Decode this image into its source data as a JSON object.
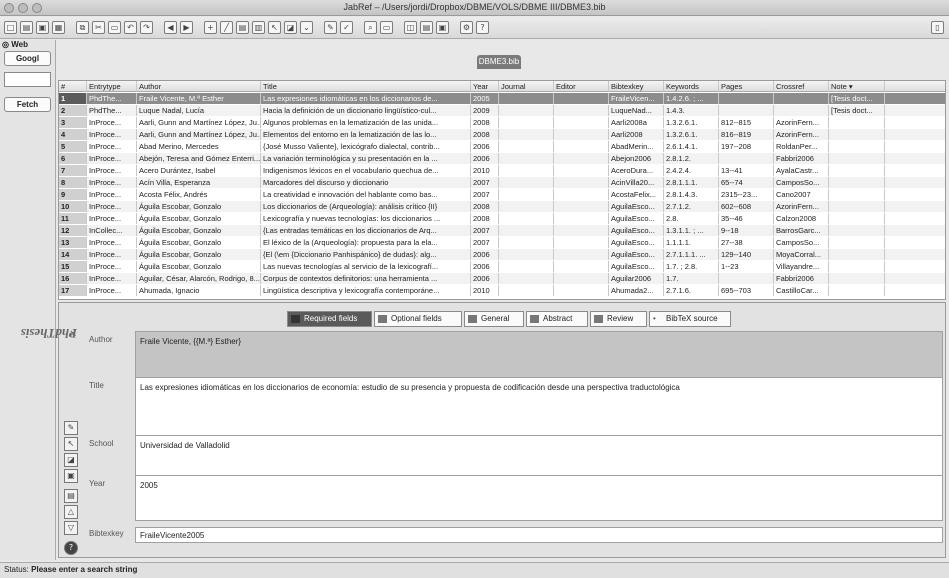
{
  "window": {
    "title": "JabRef – /Users/jordi/Dropbox/DBME/VOLS/DBME III/DBME3.bib"
  },
  "side": {
    "header": "Web",
    "google_label": "Googl",
    "fetch_label": "Fetch"
  },
  "db_tab": "DBME3.bib",
  "table": {
    "columns": [
      "#",
      "Entrytype",
      "Author",
      "Title",
      "Year",
      "Journal",
      "Editor",
      "Bibtexkey",
      "Keywords",
      "Pages",
      "Crossref",
      "Note ▾"
    ],
    "rows": [
      [
        "1",
        "PhdThe...",
        "Fraile Vicente, M.ª Esther",
        "Las expresiones idiomáticas en los diccionarios de...",
        "2005",
        "",
        "",
        "FraileVicen...",
        "1.4.2.6. ; ...",
        "",
        "",
        "[Tesis doct..."
      ],
      [
        "2",
        "PhdThe...",
        "Luque Nadal, Lucía",
        "Hacia la definición de un diccionario lingüístico-cul...",
        "2009",
        "",
        "",
        "LuqueNad...",
        "1.4.3.",
        "",
        "",
        "[Tesis doct..."
      ],
      [
        "3",
        "InProce...",
        "Aarli, Gunn and Martínez López, Ju...",
        "Algunos problemas en la lematización de las unida...",
        "2008",
        "",
        "",
        "Aarli2008a",
        "1.3.2.6.1.",
        "812--815",
        "AzorinFern...",
        ""
      ],
      [
        "4",
        "InProce...",
        "Aarli, Gunn and Martínez López, Ju...",
        "Elementos del entorno en la lematización de las lo...",
        "2008",
        "",
        "",
        "Aarli2008",
        "1.3.2.6.1.",
        "816--819",
        "AzorinFern...",
        ""
      ],
      [
        "5",
        "InProce...",
        "Abad Merino, Mercedes",
        "{José Musso Valiente}, lexicógrafo dialectal, contrib...",
        "2006",
        "",
        "",
        "AbadMerin...",
        "2.6.1.4.1.",
        "197--208",
        "RoldanPer...",
        ""
      ],
      [
        "6",
        "InProce...",
        "Abejón, Teresa and Gómez Enterri...",
        "La variación terminológica y su presentación en la ...",
        "2006",
        "",
        "",
        "Abejon2006",
        "2.8.1.2.",
        "",
        "Fabbri2006",
        ""
      ],
      [
        "7",
        "InProce...",
        "Acero Durántez, Isabel",
        "Indigenismos léxicos en el vocabulario quechua de...",
        "2010",
        "",
        "",
        "AceroDura...",
        "2.4.2.4.",
        "13--41",
        "AyalaCastr...",
        ""
      ],
      [
        "8",
        "InProce...",
        "Acín Villa, Esperanza",
        "Marcadores del discurso y diccionario",
        "2007",
        "",
        "",
        "AcinVilla20...",
        "2.8.1.1.1.",
        "65--74",
        "CamposSo...",
        ""
      ],
      [
        "9",
        "InProce...",
        "Acosta Félix, Andrés",
        "La creatividad e innovación del hablante como bas...",
        "2007",
        "",
        "",
        "AcostaFelix...",
        "2.8.1.4.3.",
        "2315--23...",
        "Cano2007",
        ""
      ],
      [
        "10",
        "InProce...",
        "Águila Escobar, Gonzalo",
        "Los diccionarios de (Arqueología): análisis crítico {II}",
        "2008",
        "",
        "",
        "AguilaEsco...",
        "2.7.1.2.",
        "602--608",
        "AzorinFern...",
        ""
      ],
      [
        "11",
        "InProce...",
        "Águila Escobar, Gonzalo",
        "Lexicografía y nuevas tecnologías: los diccionarios ...",
        "2008",
        "",
        "",
        "AguilaEsco...",
        "2.8.",
        "35--46",
        "Calzon2008",
        ""
      ],
      [
        "12",
        "InCollec...",
        "Águila Escobar, Gonzalo",
        "{Las entradas temáticas en los diccionarios de Arq...",
        "2007",
        "",
        "",
        "AguilaEsco...",
        "1.3.1.1. ; ...",
        "9--18",
        "BarrosGarc...",
        ""
      ],
      [
        "13",
        "InProce...",
        "Águila Escobar, Gonzalo",
        "El léxico de la (Arqueología): propuesta para la ela...",
        "2007",
        "",
        "",
        "AguilaEsco...",
        "1.1.1.1.",
        "27--38",
        "CamposSo...",
        ""
      ],
      [
        "14",
        "InProce...",
        "Águila Escobar, Gonzalo",
        "{El (\\em {Diccionario Panhispánico} de dudas}: alg...",
        "2006",
        "",
        "",
        "AguilaEsco...",
        "2.7.1.1.1. ...",
        "129--140",
        "MoyaCorral...",
        ""
      ],
      [
        "15",
        "InProce...",
        "Águila Escobar, Gonzalo",
        "Las nuevas tecnologías al servicio de la lexicografí...",
        "2006",
        "",
        "",
        "AguilaEsco...",
        "1.7. ; 2.8.",
        "1--23",
        "Villayandre...",
        ""
      ],
      [
        "16",
        "InProce...",
        "Aguilar, César, Alarcón, Rodrigo, 8...",
        "Corpus de contextos definitorios: una herramienta ...",
        "2006",
        "",
        "",
        "Aguilar2006",
        "1.7.",
        "",
        "Fabbri2006",
        ""
      ],
      [
        "17",
        "InProce...",
        "Ahumada, Ignacio",
        "Lingüística descriptiva y lexicografía contemporáne...",
        "2010",
        "",
        "",
        "Ahumada2...",
        "2.7.1.6.",
        "695--703",
        "CastilloCar...",
        ""
      ]
    ]
  },
  "editor": {
    "side_title": "PhdThesis",
    "close_glyph": "×",
    "tabs": [
      "Required fields",
      "Optional fields",
      "General",
      "Abstract",
      "Review",
      "BibTeX source"
    ],
    "fields": {
      "author_label": "Author",
      "author_value": "Fraile Vicente, {{M.ª} Esther}",
      "title_label": "Title",
      "title_value": "Las expresiones idiomáticas en los diccionarios de economía: estudio de su presencia y propuesta de codificación desde una perspectiva traductológica",
      "school_label": "School",
      "school_value": "Universidad de Valladolid",
      "year_label": "Year",
      "year_value": "2005",
      "bibtexkey_label": "Bibtexkey",
      "bibtexkey_value": "FraileVicente2005"
    }
  },
  "status": {
    "prefix": "Status:",
    "message": "Please enter a search string"
  }
}
